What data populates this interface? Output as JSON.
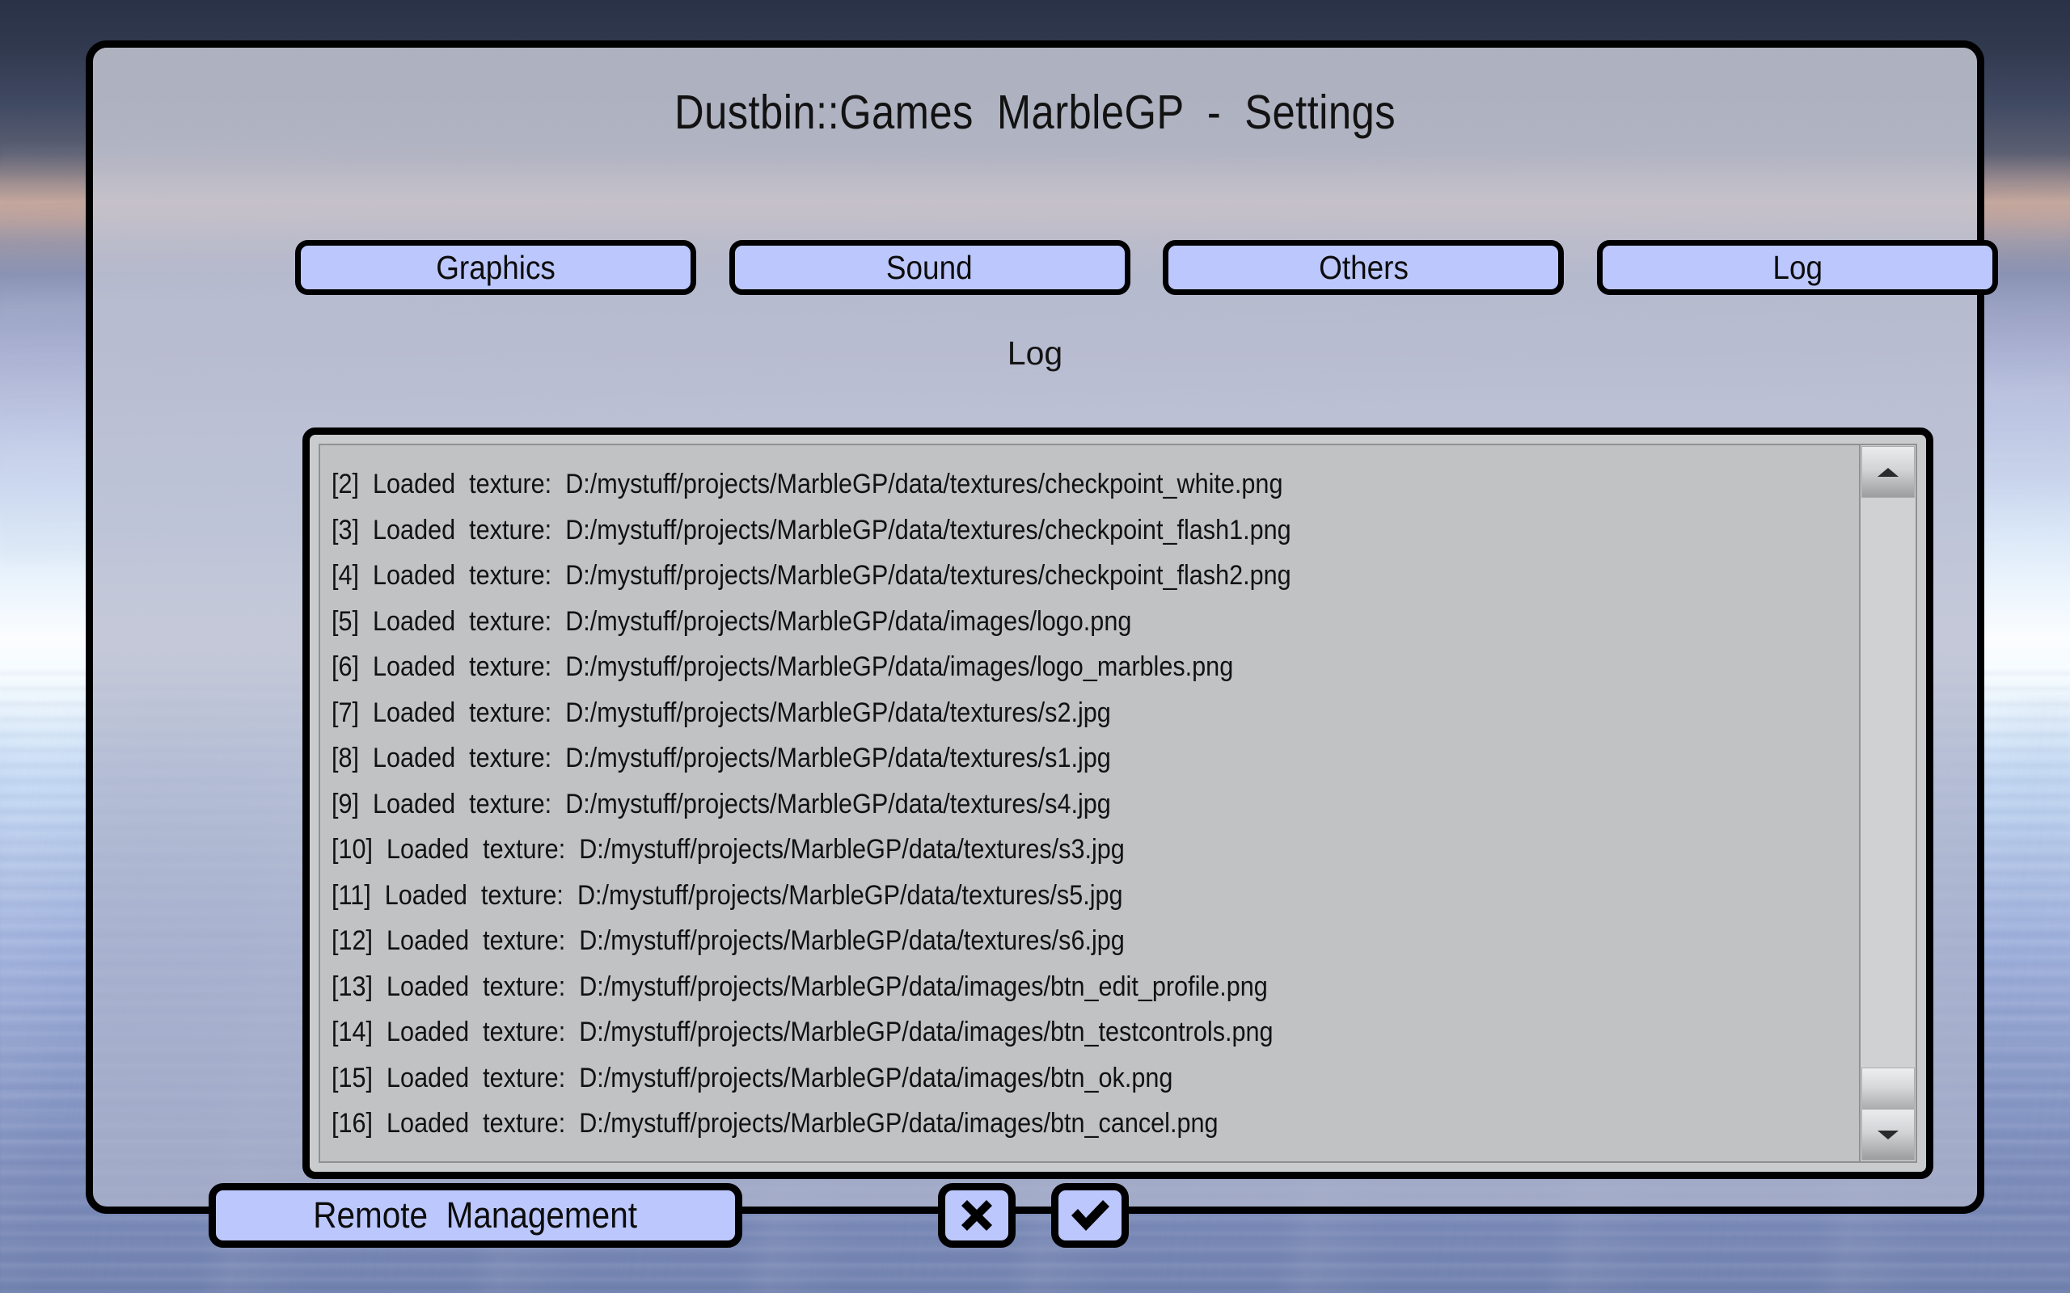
{
  "window": {
    "title": "Dustbin::Games  MarbleGP  -  Settings"
  },
  "tabs": [
    {
      "label": "Graphics"
    },
    {
      "label": "Sound"
    },
    {
      "label": "Others"
    },
    {
      "label": "Log"
    }
  ],
  "section": {
    "heading": "Log"
  },
  "log": {
    "lines": [
      "[2]  Loaded  texture:  D:/mystuff/projects/MarbleGP/data/textures/checkpoint_white.png",
      "[3]  Loaded  texture:  D:/mystuff/projects/MarbleGP/data/textures/checkpoint_flash1.png",
      "[4]  Loaded  texture:  D:/mystuff/projects/MarbleGP/data/textures/checkpoint_flash2.png",
      "[5]  Loaded  texture:  D:/mystuff/projects/MarbleGP/data/images/logo.png",
      "[6]  Loaded  texture:  D:/mystuff/projects/MarbleGP/data/images/logo_marbles.png",
      "[7]  Loaded  texture:  D:/mystuff/projects/MarbleGP/data/textures/s2.jpg",
      "[8]  Loaded  texture:  D:/mystuff/projects/MarbleGP/data/textures/s1.jpg",
      "[9]  Loaded  texture:  D:/mystuff/projects/MarbleGP/data/textures/s4.jpg",
      "[10]  Loaded  texture:  D:/mystuff/projects/MarbleGP/data/textures/s3.jpg",
      "[11]  Loaded  texture:  D:/mystuff/projects/MarbleGP/data/textures/s5.jpg",
      "[12]  Loaded  texture:  D:/mystuff/projects/MarbleGP/data/textures/s6.jpg",
      "[13]  Loaded  texture:  D:/mystuff/projects/MarbleGP/data/images/btn_edit_profile.png",
      "[14]  Loaded  texture:  D:/mystuff/projects/MarbleGP/data/images/btn_testcontrols.png",
      "[15]  Loaded  texture:  D:/mystuff/projects/MarbleGP/data/images/btn_ok.png",
      "[16]  Loaded  texture:  D:/mystuff/projects/MarbleGP/data/images/btn_cancel.png"
    ]
  },
  "scrollbar": {
    "up_icon": "chevron-up-icon",
    "down_icon": "chevron-down-icon"
  },
  "footer": {
    "remote_label": "Remote  Management",
    "cancel_icon": "cross-icon",
    "ok_icon": "check-icon"
  },
  "colors": {
    "button_fill": "#bcc7fd",
    "button_border": "#000000",
    "panel_fill": "#c0c2c4",
    "frame_fill": "#c9cbcd"
  }
}
